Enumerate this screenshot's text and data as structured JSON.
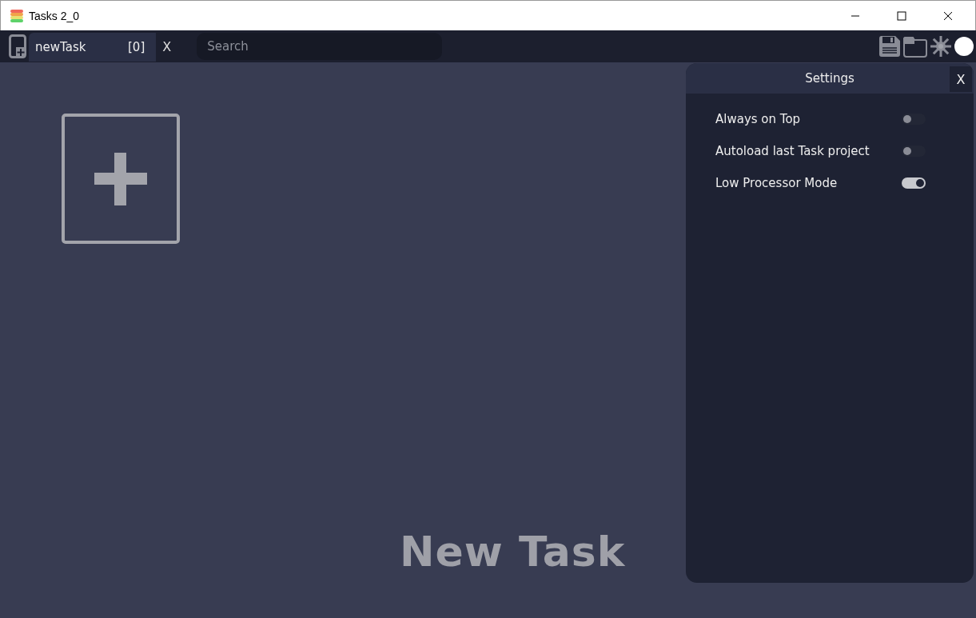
{
  "window": {
    "title": "Tasks 2_0"
  },
  "tabs": [
    {
      "label": "newTask",
      "count": "[0]",
      "close": "X",
      "selected": true
    }
  ],
  "search": {
    "placeholder": "Search"
  },
  "main": {
    "empty_label": "New Task"
  },
  "settings": {
    "title": "Settings",
    "close": "X",
    "options": [
      {
        "label": "Always on Top",
        "on": false
      },
      {
        "label": "Autoload last Task project",
        "on": false
      },
      {
        "label": "Low Processor Mode",
        "on": true
      }
    ]
  }
}
